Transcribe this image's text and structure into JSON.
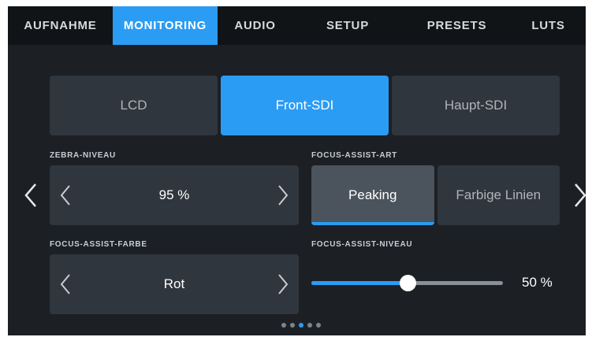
{
  "tabs": [
    {
      "label": "AUFNAHME"
    },
    {
      "label": "MONITORING"
    },
    {
      "label": "AUDIO"
    },
    {
      "label": "SETUP"
    },
    {
      "label": "PRESETS"
    },
    {
      "label": "LUTS"
    }
  ],
  "active_tab": "MONITORING",
  "outputs": [
    {
      "label": "LCD"
    },
    {
      "label": "Front-SDI"
    },
    {
      "label": "Haupt-SDI"
    }
  ],
  "active_output": "Front-SDI",
  "zebra": {
    "label": "ZEBRA-NIVEAU",
    "value": "95 %"
  },
  "focus_type": {
    "label": "FOCUS-ASSIST-ART",
    "options": [
      {
        "label": "Peaking"
      },
      {
        "label": "Farbige Linien"
      }
    ],
    "selected": "Peaking"
  },
  "focus_color": {
    "label": "FOCUS-ASSIST-FARBE",
    "value": "Rot"
  },
  "focus_level": {
    "label": "FOCUS-ASSIST-NIVEAU",
    "value_text": "50 %",
    "level": 0.5
  },
  "pagination": {
    "pages": 5,
    "current": 3
  },
  "colors": {
    "accent": "#2b9cf4",
    "panel": "#30363d",
    "background": "#1c2025"
  },
  "icons": [
    "chevron-left-icon",
    "chevron-right-icon"
  ]
}
